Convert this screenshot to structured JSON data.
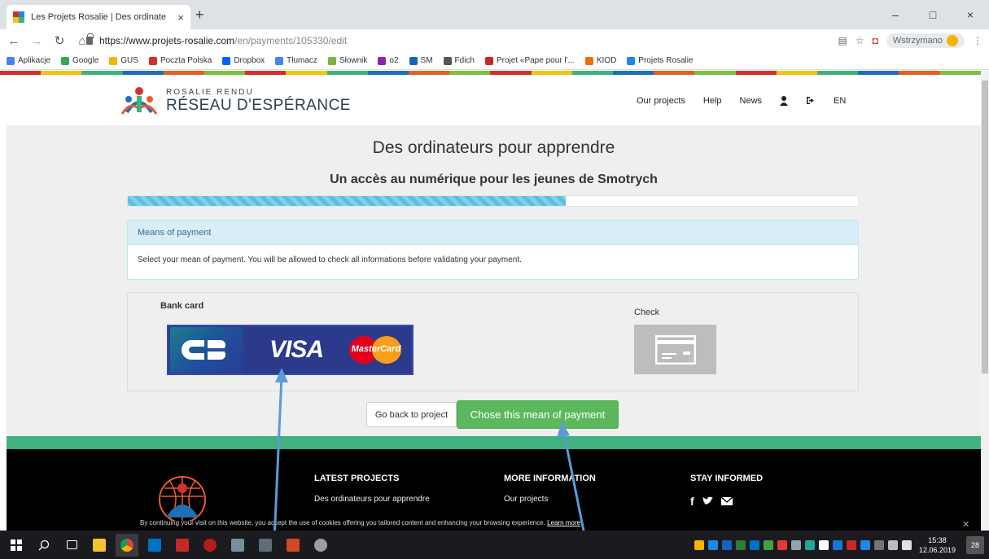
{
  "browser": {
    "tab_title": "Les Projets Rosalie | Des ordinate",
    "tab_close": "×",
    "new_tab": "+",
    "url_host": "https://www.projets-rosalie.com",
    "url_path": "/en/payments/105330/edit",
    "profile_name": "Wstrzymano",
    "window_minimize": "–",
    "window_maximize": "□",
    "window_close": "×",
    "bookmarks": [
      {
        "label": "Aplikacje",
        "color": "#4285f4"
      },
      {
        "label": "Google",
        "color": "#34a853"
      },
      {
        "label": "GUS",
        "color": "#f4b400"
      },
      {
        "label": "Poczta Polska",
        "color": "#d32f2f"
      },
      {
        "label": "Dropbox",
        "color": "#0061fe"
      },
      {
        "label": "Tłumacz",
        "color": "#4285f4"
      },
      {
        "label": "Słownik",
        "color": "#7cb342"
      },
      {
        "label": "o2",
        "color": "#8e24aa"
      },
      {
        "label": "SM",
        "color": "#1565c0"
      },
      {
        "label": "Fdich",
        "color": "#555555"
      },
      {
        "label": "Projet «Pape pour l'...",
        "color": "#c62828"
      },
      {
        "label": "KIOD",
        "color": "#ef6c00"
      },
      {
        "label": "Projets Rosalie",
        "color": "#1e88e5"
      }
    ]
  },
  "site": {
    "logo_small": "ROSALIE RENDU",
    "logo_big": "RÉSEAU D'ESPÉRANCE",
    "nav": [
      "Our projects",
      "Help",
      "News"
    ],
    "lang": "EN",
    "accent_colors": [
      "#d32f2f",
      "#f0c419",
      "#3fb27f",
      "#1e6fb5",
      "#e85d26",
      "#7bc043"
    ]
  },
  "page": {
    "title": "Des ordinateurs pour apprendre",
    "subtitle": "Un accès au numérique pour les jeunes de Smotrych",
    "progress_percent": 60
  },
  "panel": {
    "heading": "Means of payment",
    "body": "Select your mean of payment. You will be allowed to check all informations before validating your payment."
  },
  "methods": {
    "bank_card_label": "Bank card",
    "visa": "VISA",
    "mastercard": "MasterCard",
    "check_label": "Check"
  },
  "actions": {
    "back": "Go back to project",
    "choose": "Chose this mean of payment"
  },
  "footer": {
    "latest_heading": "LATEST PROJECTS",
    "latest_link": "Des ordinateurs pour apprendre",
    "more_heading": "MORE INFORMATION",
    "more_link": "Our projects",
    "stay_heading": "STAY INFORMED",
    "cookie_text": "By continuing your visit on this website, you accept the use of cookies offering you tailored content and enhancing your browsing experience.",
    "cookie_link": "Learn more",
    "cookie_close": "×"
  },
  "taskbar": {
    "time": "15:38",
    "date": "12.06.2019",
    "notifications": "28"
  }
}
